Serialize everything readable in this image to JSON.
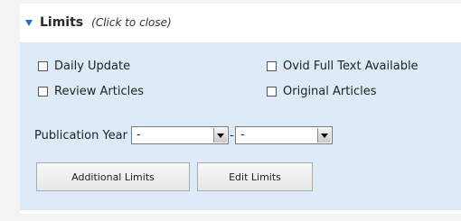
{
  "limits": {
    "title": "Limits",
    "hint": "(Click to close)",
    "checkboxes": [
      {
        "label": "Daily Update",
        "checked": false
      },
      {
        "label": "Ovid Full Text Available",
        "checked": false
      },
      {
        "label": "Review Articles",
        "checked": false
      },
      {
        "label": "Original Articles",
        "checked": false
      }
    ],
    "publication_year": {
      "label": "Publication Year",
      "from_value": "-",
      "separator": "-",
      "to_value": "-"
    },
    "buttons": {
      "additional": "Additional Limits",
      "edit": "Edit Limits"
    }
  },
  "colors": {
    "accent": "#1e73c8",
    "panel_bg": "#dcebf7"
  }
}
